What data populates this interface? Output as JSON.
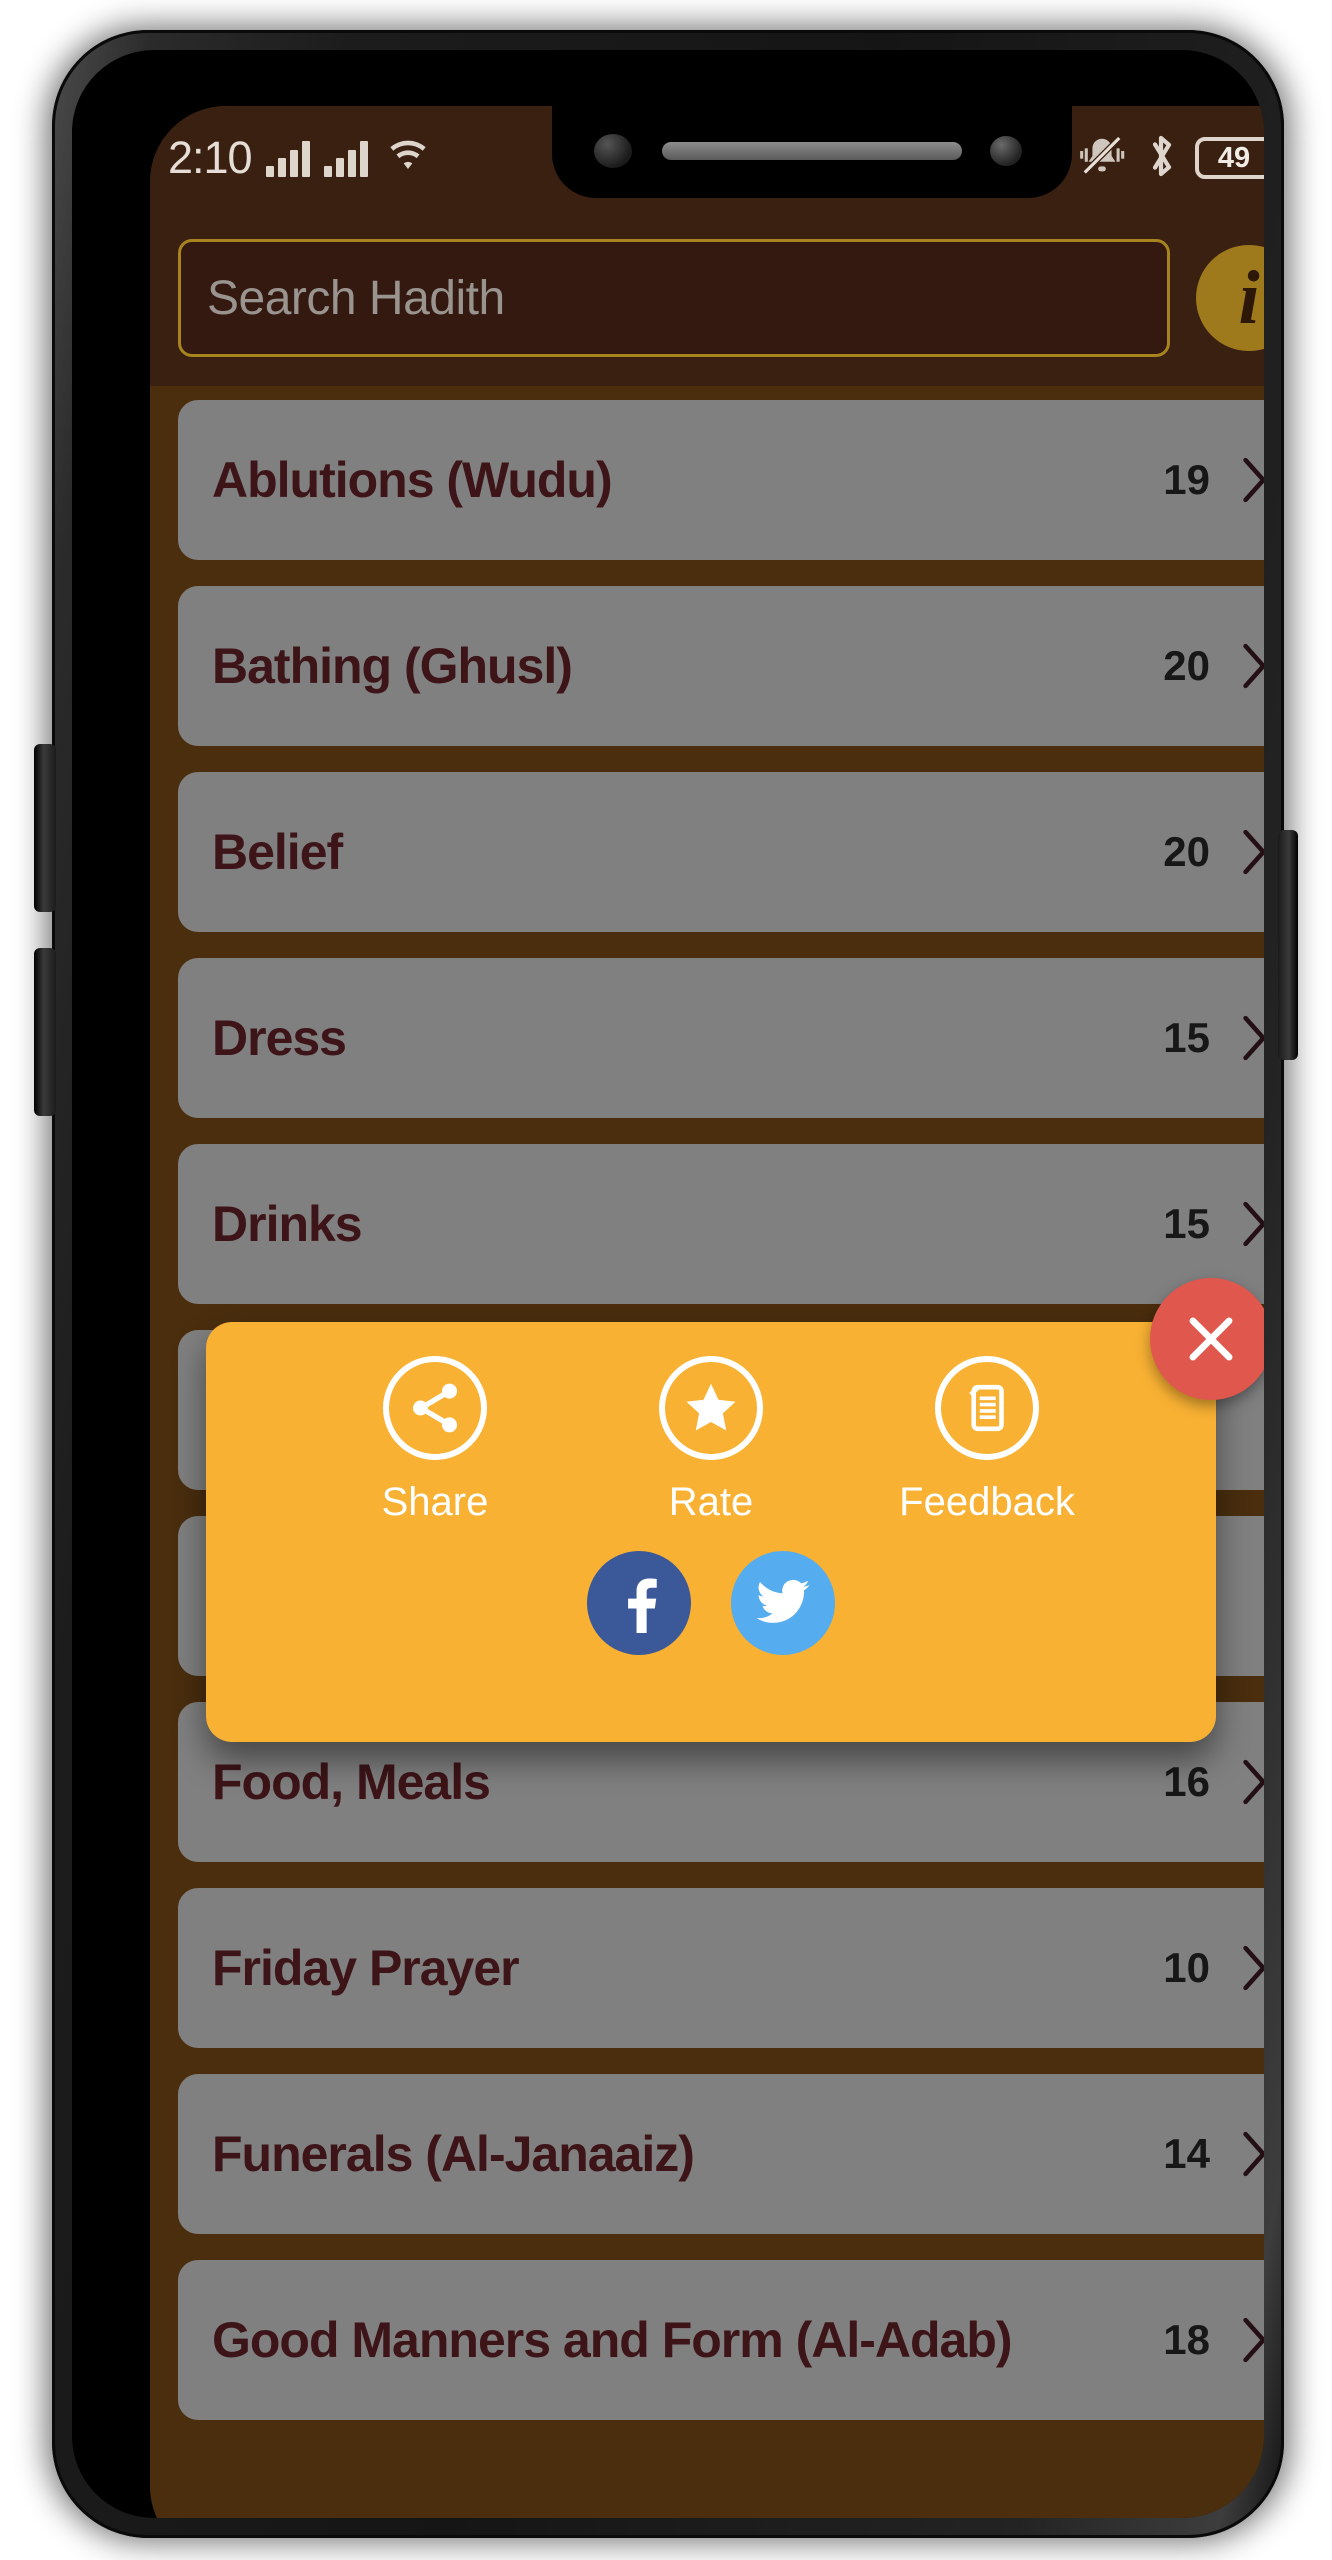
{
  "status_bar": {
    "time": "2:10",
    "battery_percent": "49",
    "icons": [
      "signal-bars-icon",
      "signal-bars-icon",
      "wifi-icon",
      "mute-bell-icon",
      "bluetooth-icon",
      "battery-icon"
    ]
  },
  "header": {
    "search_placeholder": "Search Hadith",
    "search_value": "",
    "info_label": "i"
  },
  "list": {
    "items": [
      {
        "label": "Ablutions (Wudu)",
        "count": "19"
      },
      {
        "label": "Bathing (Ghusl)",
        "count": "20"
      },
      {
        "label": "Belief",
        "count": "20"
      },
      {
        "label": "Dress",
        "count": "15"
      },
      {
        "label": "Drinks",
        "count": "15"
      },
      {
        "label": "",
        "count": ""
      },
      {
        "label": "",
        "count": ""
      },
      {
        "label": "Food, Meals",
        "count": "16"
      },
      {
        "label": "Friday Prayer",
        "count": "10"
      },
      {
        "label": "Funerals (Al-Janaaiz)",
        "count": "14"
      },
      {
        "label": "Good Manners and Form (Al-Adab)",
        "count": "18"
      }
    ]
  },
  "dialog": {
    "actions": [
      {
        "label": "Share",
        "icon": "share-icon"
      },
      {
        "label": "Rate",
        "icon": "star-icon"
      },
      {
        "label": "Feedback",
        "icon": "document-icon"
      }
    ],
    "social": [
      {
        "name": "facebook",
        "icon": "facebook-icon"
      },
      {
        "name": "twitter",
        "icon": "twitter-icon"
      }
    ],
    "close_icon": "close-icon"
  },
  "colors": {
    "screen_background": "#4a2e0e",
    "header_background": "#3a2011",
    "accent_gold": "#a7841d",
    "list_item_background": "#808080",
    "list_item_text": "#3d1418",
    "dialog_background": "#f8b133",
    "close_button": "#e0574d",
    "facebook_blue": "#3b5998",
    "twitter_blue": "#55acee"
  }
}
